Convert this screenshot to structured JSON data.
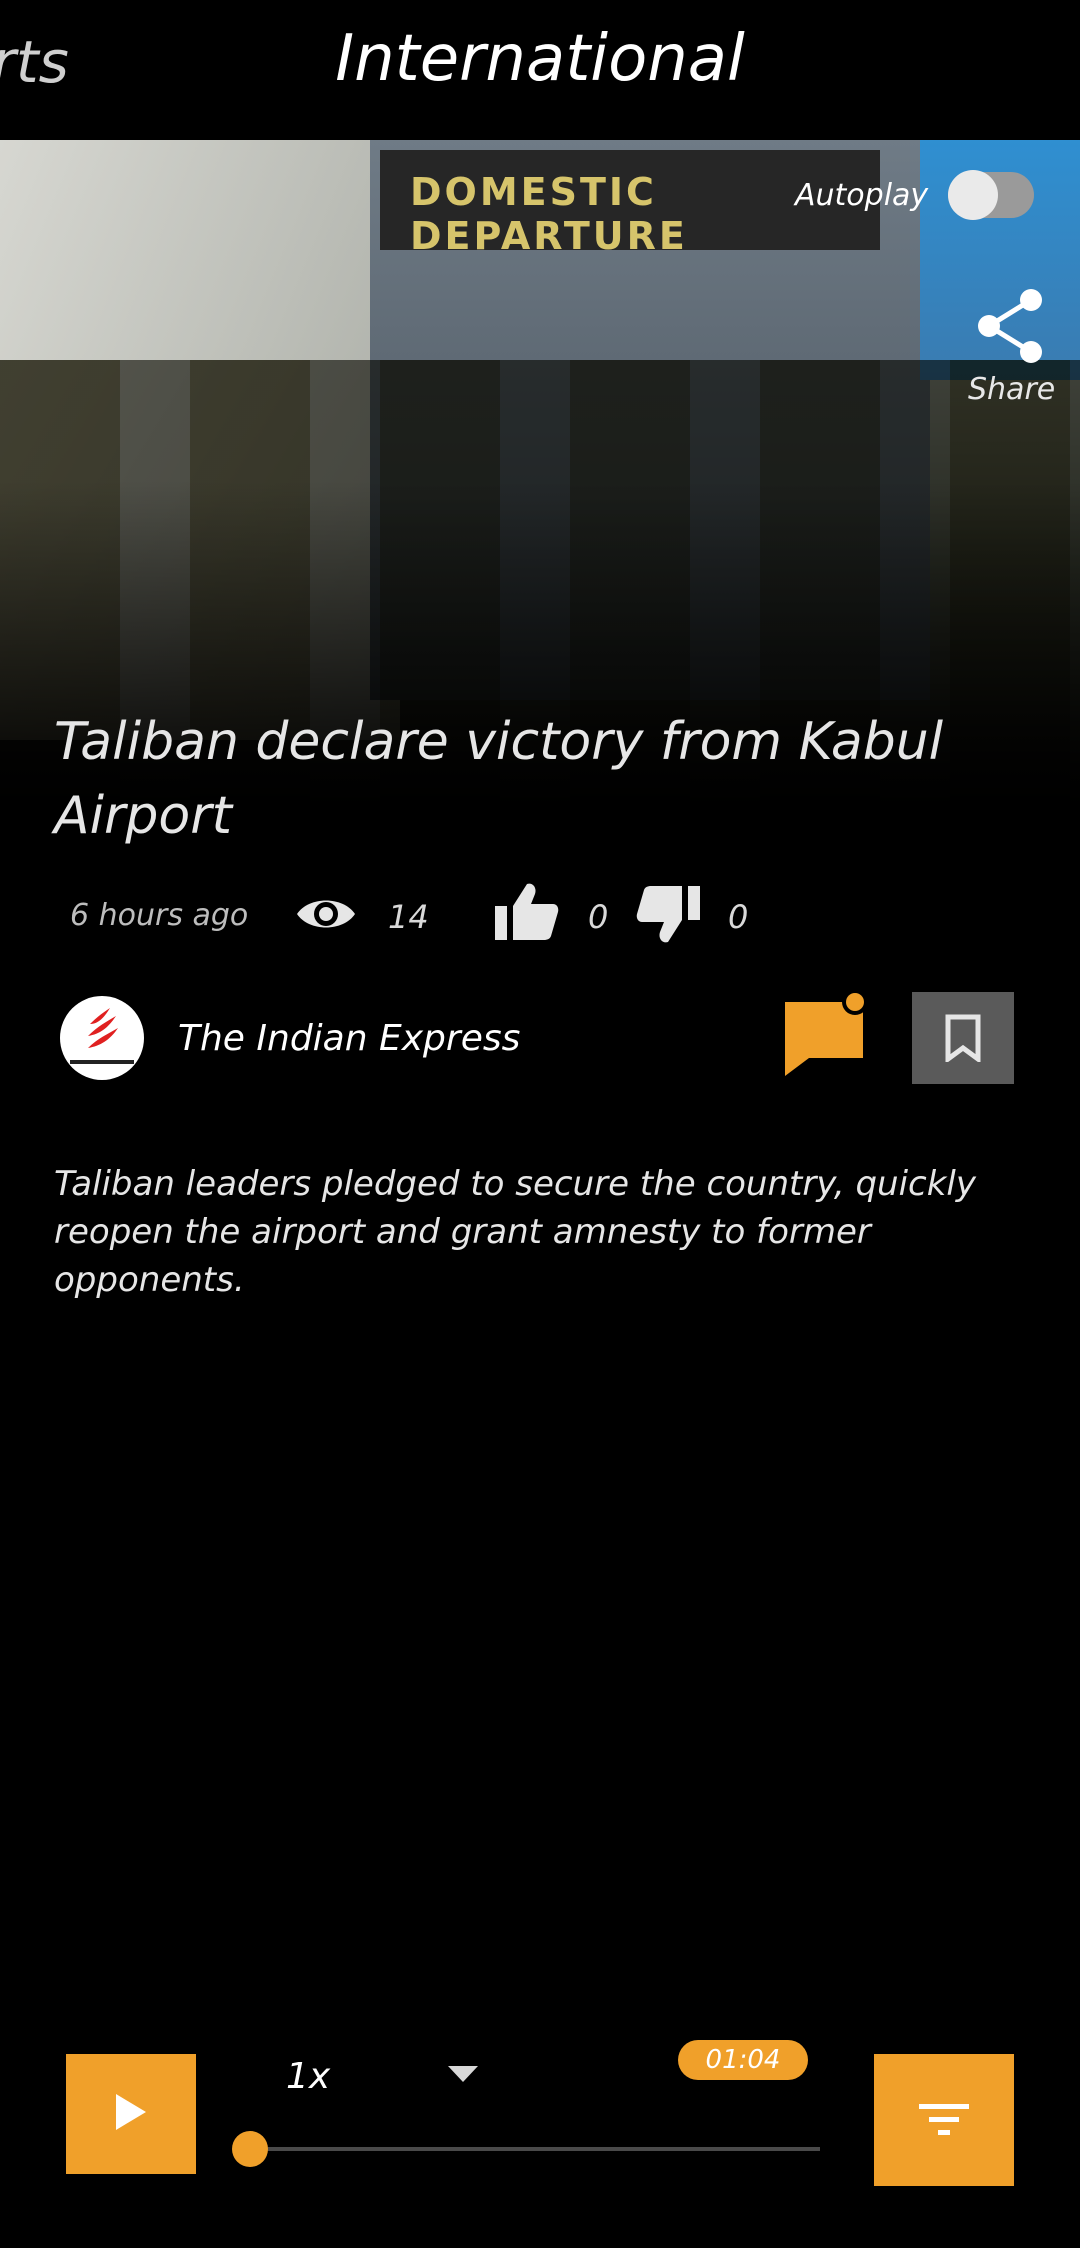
{
  "tabs": {
    "previous_partial": "rts",
    "current": "International"
  },
  "hero": {
    "autoplay_label": "Autoplay",
    "autoplay_on": false,
    "share_label": "Share",
    "sign_text": "DOMESTIC DEPARTURE"
  },
  "article": {
    "headline": "Taliban declare victory from Kabul Airport",
    "time_ago": "6 hours ago",
    "views": "14",
    "likes": "0",
    "dislikes": "0",
    "source_name": "The Indian Express",
    "summary": "Taliban leaders pledged to secure the country, quickly reopen the airport and grant amnesty to former opponents."
  },
  "player": {
    "speed": "1x",
    "duration": "01:04",
    "progress_fraction": 0.0
  },
  "colors": {
    "accent": "#f0a02a",
    "background": "#000000",
    "bookmark_bg": "#5a5a5a",
    "toggle_track": "#9a9a9a"
  }
}
